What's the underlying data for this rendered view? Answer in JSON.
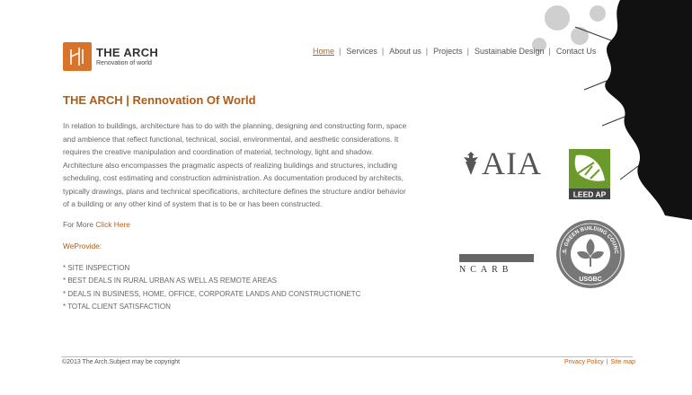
{
  "logo": {
    "title": "THE ARCH",
    "subtitle": "Renovation of world",
    "mark_color": "#d9722a"
  },
  "nav": {
    "items": [
      "Home",
      "Services",
      "About us",
      "Projects",
      "Sustainable Design",
      "Contact Us"
    ],
    "active": "Home",
    "separator": "|"
  },
  "content": {
    "headline": "THE ARCH | Rennovation Of World",
    "paragraph": "In relation to buildings, architecture has to do with the planning, designing and constructing form, space and ambience that reflect functional, technical, social, environmental, and aesthetic considerations. It requires the creative manipulation and coordination of material, technology, light and shadow. Architecture also encompasses the pragmatic aspects of realizing buildings and structures, including scheduling, cost estimating and construction administration. As documentation produced by architects, typically drawings, plans and technical specifications, architecture defines the structure and/or behavior of a building or any other kind of system that is to be or has been constructed.",
    "more_prefix": "For More",
    "more_link": "Click Here",
    "we_provide": "WeProvide:",
    "list": [
      "* SITE INSPECTION",
      "* BEST DEALS IN RURAL URBAN AS WELL AS REMOTE AREAS",
      "* DEALS IN BUSINESS, HOME, OFFICE, CORPORATE LANDS AND CONSTRUCTIONETC",
      "* TOTAL CLIENT SATISFACTION"
    ]
  },
  "badges": {
    "aia": "AIA",
    "leed": "LEED AP",
    "ncarb": "NCARB",
    "usgbc_ring": "U.S. GREEN BUILDING COUNCIL",
    "usgbc": "USGBC"
  },
  "footer": {
    "copyright": "©2013  The Arch.Subject may be copyright",
    "links": [
      "Privacy Policy",
      "Site map"
    ]
  },
  "colors": {
    "accent": "#c06015",
    "heading": "#b15c12",
    "leed_green": "#6a9a2a"
  }
}
